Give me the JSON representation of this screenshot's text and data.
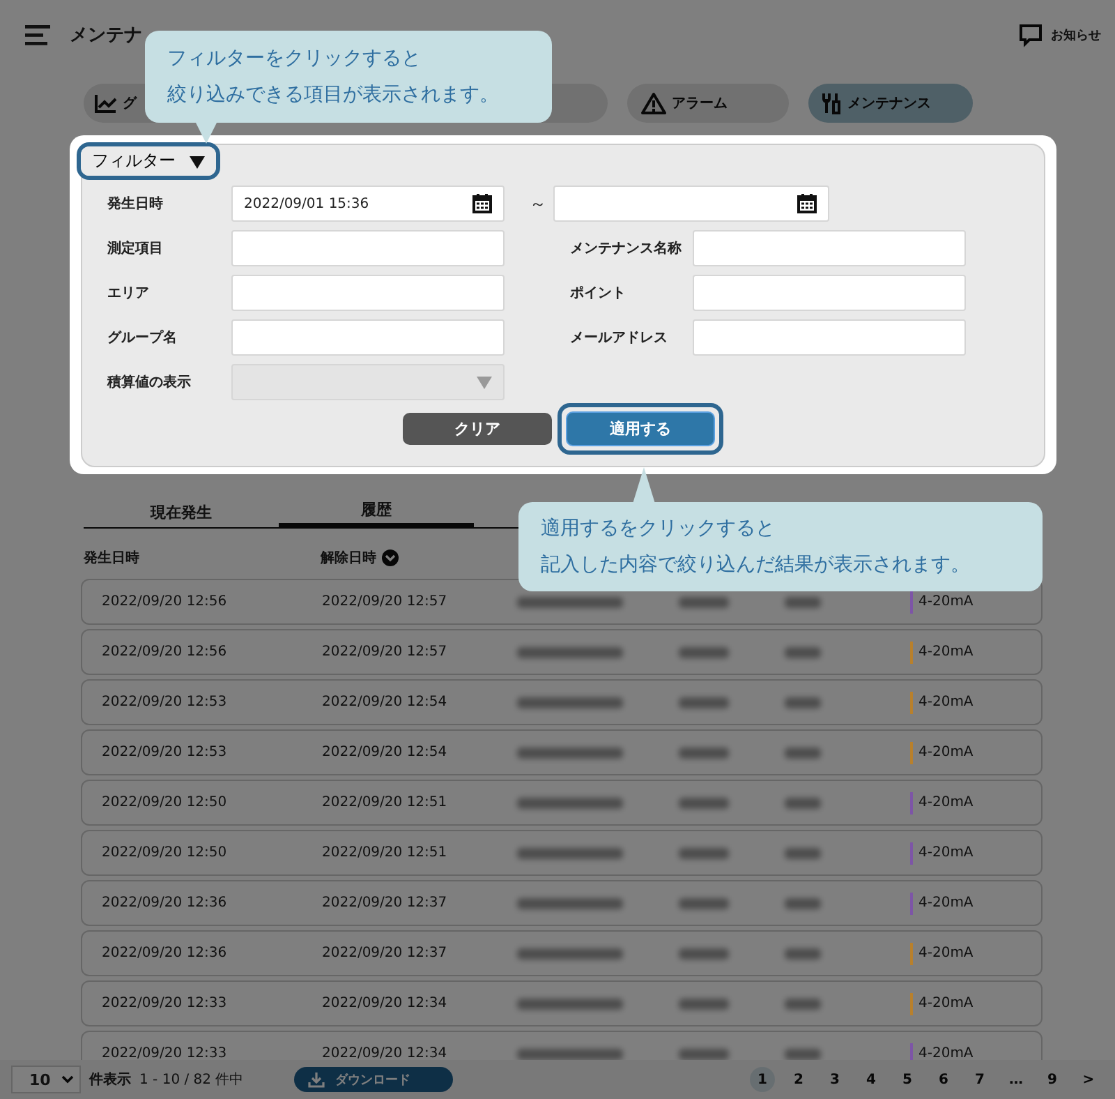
{
  "header": {
    "title": "メンテナ",
    "notification": "お知らせ"
  },
  "nav": [
    {
      "label": "グ",
      "selected": false
    },
    {
      "label": "アラーム",
      "selected": false
    },
    {
      "label": "メンテナンス",
      "selected": true
    }
  ],
  "filter": {
    "toggle": "フィルター",
    "expanded": true,
    "date": {
      "label": "発生日時",
      "from": "2022/09/01 15:36",
      "separator": "～"
    },
    "left_fields": [
      {
        "label": "測定項目"
      },
      {
        "label": "エリア"
      },
      {
        "label": "グループ名"
      }
    ],
    "right_fields": [
      {
        "label": "メンテナンス名称"
      },
      {
        "label": "ポイント"
      },
      {
        "label": "メールアドレス"
      }
    ],
    "select": {
      "label": "積算値の表示",
      "disabled": true
    },
    "buttons": {
      "clear": "クリア",
      "apply": "適用する"
    }
  },
  "callouts": [
    {
      "lines": [
        "フィルターをクリックすると",
        "絞り込みできる項目が表示されます。"
      ]
    },
    {
      "lines": [
        "適用するをクリックすると",
        "記入した内容で絞り込んだ結果が表示されます。"
      ]
    }
  ],
  "tabs": [
    {
      "label": "現在発生",
      "selected": false
    },
    {
      "label": "履歴",
      "selected": true
    }
  ],
  "columns": [
    "発生日時",
    "解除日時"
  ],
  "rows": [
    {
      "occurred": "2022/09/20 12:56",
      "cleared": "2022/09/20 12:57",
      "type": "4-20mA",
      "color": "#7d55a6"
    },
    {
      "occurred": "2022/09/20 12:56",
      "cleared": "2022/09/20 12:57",
      "type": "4-20mA",
      "color": "#b8802c"
    },
    {
      "occurred": "2022/09/20 12:53",
      "cleared": "2022/09/20 12:54",
      "type": "4-20mA",
      "color": "#b8802c"
    },
    {
      "occurred": "2022/09/20 12:53",
      "cleared": "2022/09/20 12:54",
      "type": "4-20mA",
      "color": "#b8802c"
    },
    {
      "occurred": "2022/09/20 12:50",
      "cleared": "2022/09/20 12:51",
      "type": "4-20mA",
      "color": "#7d55a6"
    },
    {
      "occurred": "2022/09/20 12:50",
      "cleared": "2022/09/20 12:51",
      "type": "4-20mA",
      "color": "#7d55a6"
    },
    {
      "occurred": "2022/09/20 12:36",
      "cleared": "2022/09/20 12:37",
      "type": "4-20mA",
      "color": "#7d55a6"
    },
    {
      "occurred": "2022/09/20 12:36",
      "cleared": "2022/09/20 12:37",
      "type": "4-20mA",
      "color": "#b8802c"
    },
    {
      "occurred": "2022/09/20 12:33",
      "cleared": "2022/09/20 12:34",
      "type": "4-20mA",
      "color": "#b8802c"
    },
    {
      "occurred": "2022/09/20 12:33",
      "cleared": "2022/09/20 12:34",
      "type": "4-20mA",
      "color": "#7d55a6"
    }
  ],
  "footer": {
    "page_size": "10",
    "per_page_label": "件表示",
    "range": "1 - 10 / 82 件中",
    "download": "ダウンロード",
    "pages": [
      {
        "label": "1",
        "selected": true
      },
      {
        "label": "2",
        "selected": false
      },
      {
        "label": "3",
        "selected": false
      },
      {
        "label": "4",
        "selected": false
      },
      {
        "label": "5",
        "selected": false
      },
      {
        "label": "6",
        "selected": false
      },
      {
        "label": "7",
        "selected": false
      },
      {
        "label": "…",
        "selected": false
      },
      {
        "label": "9",
        "selected": false
      }
    ],
    "next": ">"
  }
}
